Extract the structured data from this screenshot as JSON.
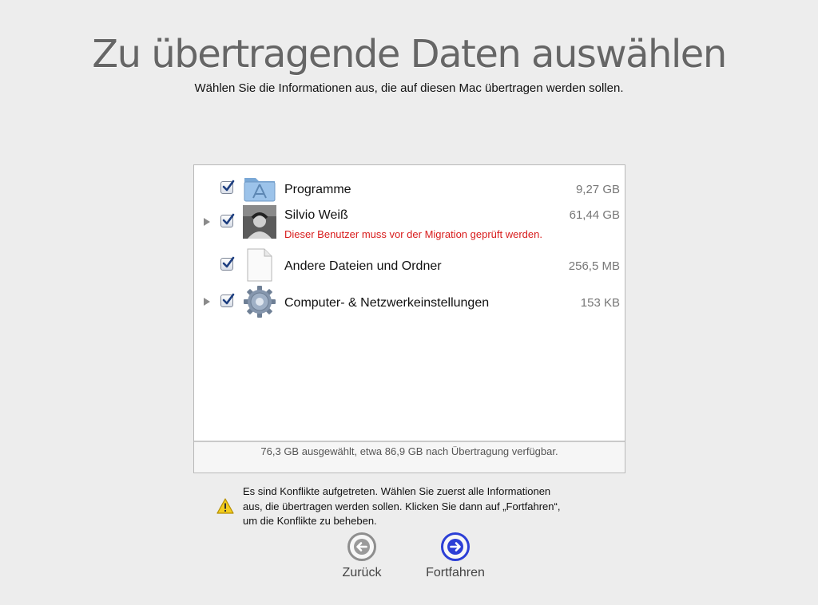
{
  "header": {
    "title": "Zu übertragende Daten auswählen",
    "subtitle": "Wählen Sie die Informationen aus, die auf diesen Mac übertragen werden sollen."
  },
  "items": [
    {
      "label": "Programme",
      "size": "9,27 GB",
      "checked": true,
      "expandable": false,
      "icon": "applications-folder-icon"
    },
    {
      "label": "Silvio Weiß",
      "size": "61,44 GB",
      "checked": true,
      "expandable": true,
      "icon": "user-photo-icon",
      "warning": "Dieser Benutzer muss vor der Migration geprüft werden."
    },
    {
      "label": "Andere Dateien und Ordner",
      "size": "256,5 MB",
      "checked": true,
      "expandable": false,
      "icon": "document-icon"
    },
    {
      "label": "Computer- & Netzwerkeinstellungen",
      "size": "153 KB",
      "checked": true,
      "expandable": true,
      "icon": "gear-icon"
    }
  ],
  "summary": "76,3 GB ausgewählt, etwa 86,9 GB nach Übertragung verfügbar.",
  "conflict": {
    "line1": "Es sind Konflikte aufgetreten. Wählen Sie zuerst alle Informationen",
    "line2": "aus, die übertragen werden sollen. Klicken Sie dann auf „Fortfahren“,",
    "line3": "um die Konflikte zu beheben."
  },
  "nav": {
    "back": "Zurück",
    "continue": "Fortfahren"
  },
  "colors": {
    "warning_text": "#d81c1c",
    "continue_accent": "#2c3fd6",
    "back_gray": "#8e8e8e"
  }
}
